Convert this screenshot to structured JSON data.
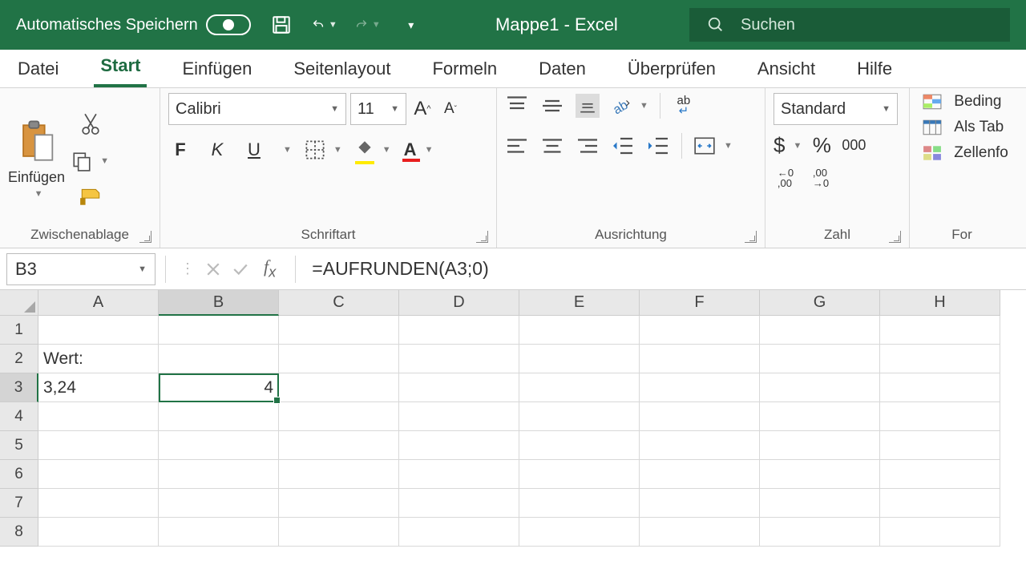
{
  "titlebar": {
    "autosave": "Automatisches Speichern",
    "title": "Mappe1  -  Excel",
    "search_placeholder": "Suchen"
  },
  "tabs": [
    "Datei",
    "Start",
    "Einfügen",
    "Seitenlayout",
    "Formeln",
    "Daten",
    "Überprüfen",
    "Ansicht",
    "Hilfe"
  ],
  "active_tab": 1,
  "ribbon": {
    "clipboard": {
      "paste": "Einfügen",
      "label": "Zwischenablage"
    },
    "font": {
      "name": "Calibri",
      "size": "11",
      "bold": "F",
      "italic": "K",
      "underline": "U",
      "label": "Schriftart"
    },
    "align": {
      "label": "Ausrichtung"
    },
    "number": {
      "format": "Standard",
      "thousand": "000",
      "label": "Zahl"
    },
    "styles": {
      "cond": "Beding",
      "astable": "Als Tab",
      "cellstyle": "Zellenfo",
      "label": "For"
    }
  },
  "formula_bar": {
    "cell_ref": "B3",
    "formula": "=AUFRUNDEN(A3;0)"
  },
  "grid": {
    "columns": [
      "A",
      "B",
      "C",
      "D",
      "E",
      "F",
      "G",
      "H"
    ],
    "rows": [
      "1",
      "2",
      "3",
      "4",
      "5",
      "6",
      "7",
      "8"
    ],
    "selected_col": 1,
    "selected_row": 2,
    "cells": {
      "A2": "Wert:",
      "A3": "3,24",
      "B3": "4"
    }
  }
}
